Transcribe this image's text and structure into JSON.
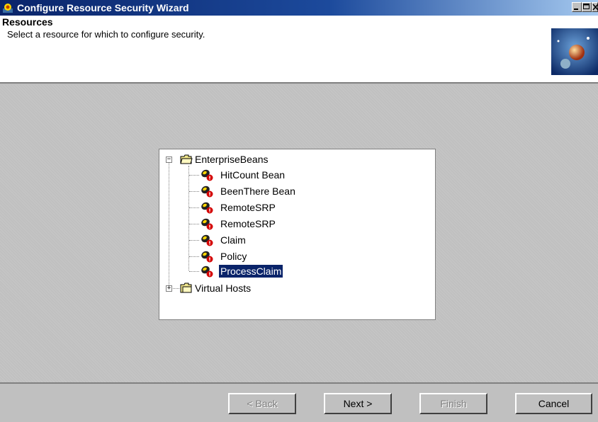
{
  "window": {
    "title": "Configure Resource Security Wizard",
    "controls": [
      "minimize",
      "maximize",
      "close"
    ]
  },
  "header": {
    "title": "Resources",
    "subtitle": "Select a resource for which to configure security."
  },
  "tree": {
    "root": {
      "label": "EnterpriseBeans",
      "expanded": true
    },
    "children": [
      {
        "label": "HitCount Bean",
        "selected": false
      },
      {
        "label": "BeenThere Bean",
        "selected": false
      },
      {
        "label": "RemoteSRP",
        "selected": false
      },
      {
        "label": "RemoteSRP",
        "selected": false
      },
      {
        "label": "Claim",
        "selected": false
      },
      {
        "label": "Policy",
        "selected": false
      },
      {
        "label": "ProcessClaim",
        "selected": true
      }
    ],
    "second_root": {
      "label": "Virtual Hosts",
      "expanded": false
    }
  },
  "footer": {
    "back_label": "< Back",
    "next_label": "Next >",
    "finish_label": "Finish",
    "cancel_label": "Cancel"
  },
  "colors": {
    "titlebar_start": "#0a246a",
    "titlebar_end": "#a6caf0",
    "selection": "#0a246a",
    "dialog_bg": "#c0c0c0"
  },
  "icons": {
    "app": "wizard-app-icon",
    "folder": "folder-icon",
    "bean": "bean-restricted-icon",
    "header_logo": "globe-logo"
  }
}
